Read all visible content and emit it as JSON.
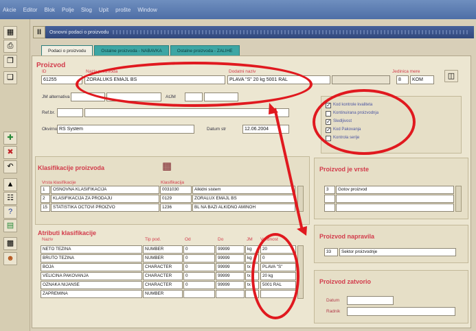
{
  "menu": [
    "Akcie",
    "Editor",
    "Blok",
    "Polje",
    "Slog",
    "Upit",
    "prošte",
    "Window"
  ],
  "window": {
    "title": "Osnovni podaci o proizvodu",
    "icon_text": "II"
  },
  "tabs": [
    {
      "label": "Podaci o proizvodu",
      "active": true
    },
    {
      "label": "Ostalne proizvoda - NABAVKA"
    },
    {
      "label": "Ostalne proizvoda - ZALIHE"
    }
  ],
  "proizvod": {
    "section": "Proizvod",
    "id_label": "ID",
    "id_value": "61255",
    "name_label": "Naziv proizvoda",
    "name_value": "ZORALUKS EMAJL BS",
    "extra_label": "Dodatni naziv",
    "extra_value": "PLAVA \"S\" 20 kg 5001 RAL",
    "unit_label": "Jedinica mere",
    "unit_code": "8",
    "unit_value": "KOM",
    "jm_label": "JM alternativa",
    "atjm_label": "AtJM",
    "ref_label": "Ref.br.",
    "owner_label": "Okvirno",
    "owner_value": "RS System",
    "date_label": "Datum str",
    "date_value": "12.06.2004"
  },
  "checkboxes": [
    {
      "label": "Kod kontrole kvaliteta",
      "checked": true
    },
    {
      "label": "Kontinuirana proizvodnja",
      "checked": false
    },
    {
      "label": "Sledljivost",
      "checked": true
    },
    {
      "label": "Kod Pakovanja",
      "checked": true
    },
    {
      "label": "Kontrola serije",
      "checked": false
    }
  ],
  "klasifikacije": {
    "title": "Klasifikacije proizvoda",
    "col1": "Vrsta klasifikacije",
    "col2": "Klasifikacija",
    "rows": [
      {
        "n": "1",
        "vrsta": "OSNOVNA KLASIFIKACIJA",
        "code": "0031030",
        "naziv": "Alkidni sistem"
      },
      {
        "n": "2",
        "vrsta": "KLASIFIKACIJA ZA PRODAJU",
        "code": "0129",
        "naziv": "ZORALUX EMAJL BS"
      },
      {
        "n": "15",
        "vrsta": "STATISTIKA OCTOVI PROIZVO",
        "code": "1236",
        "naziv": "BL NA BAZI ALKIDNO AMINOH"
      }
    ]
  },
  "atributi": {
    "title": "Atributi klasifikacije",
    "cols": [
      "Naziv",
      "Tip pod.",
      "Od",
      "Do",
      "JM",
      "Vrednost"
    ],
    "rows": [
      {
        "naziv": "NETO TEZINA",
        "tip": "NUMBER",
        "od": "0",
        "do": "99999",
        "jm": "kg",
        "vrednost": "20"
      },
      {
        "naziv": "BRUTO TEZINA",
        "tip": "NUMBER",
        "od": "0",
        "do": "99999",
        "jm": "kg",
        "vrednost": "0"
      },
      {
        "naziv": "BOJA",
        "tip": "CHARACTER",
        "od": "0",
        "do": "99999",
        "jm": "tx",
        "vrednost": "PLAVA \"S\""
      },
      {
        "naziv": "VELICINA PAKOVANJA",
        "tip": "CHARACTER",
        "od": "0",
        "do": "99999",
        "jm": "tx",
        "vrednost": "20 kg"
      },
      {
        "naziv": "OZNAKA NIJANSE",
        "tip": "CHARACTER",
        "od": "0",
        "do": "99999",
        "jm": "tx",
        "vrednost": "5001 RAL"
      },
      {
        "naziv": "ZAPREMINA",
        "tip": "NUMBER",
        "od": "",
        "do": "",
        "jm": "",
        "vrednost": ""
      }
    ]
  },
  "vrste": {
    "title": "Proizvod je vrste",
    "code": "3",
    "value": "Gotov proizvod"
  },
  "napravila": {
    "title": "Proizvod napravila",
    "code": "33",
    "value": "Sektor proizvodnje"
  },
  "zatvorio": {
    "title": "Proizvod zatvorio",
    "datum_label": "Datum",
    "radnik_label": "Radnik"
  },
  "colors": {
    "accent": "#d23b4b",
    "highlight": "#e0191f"
  }
}
